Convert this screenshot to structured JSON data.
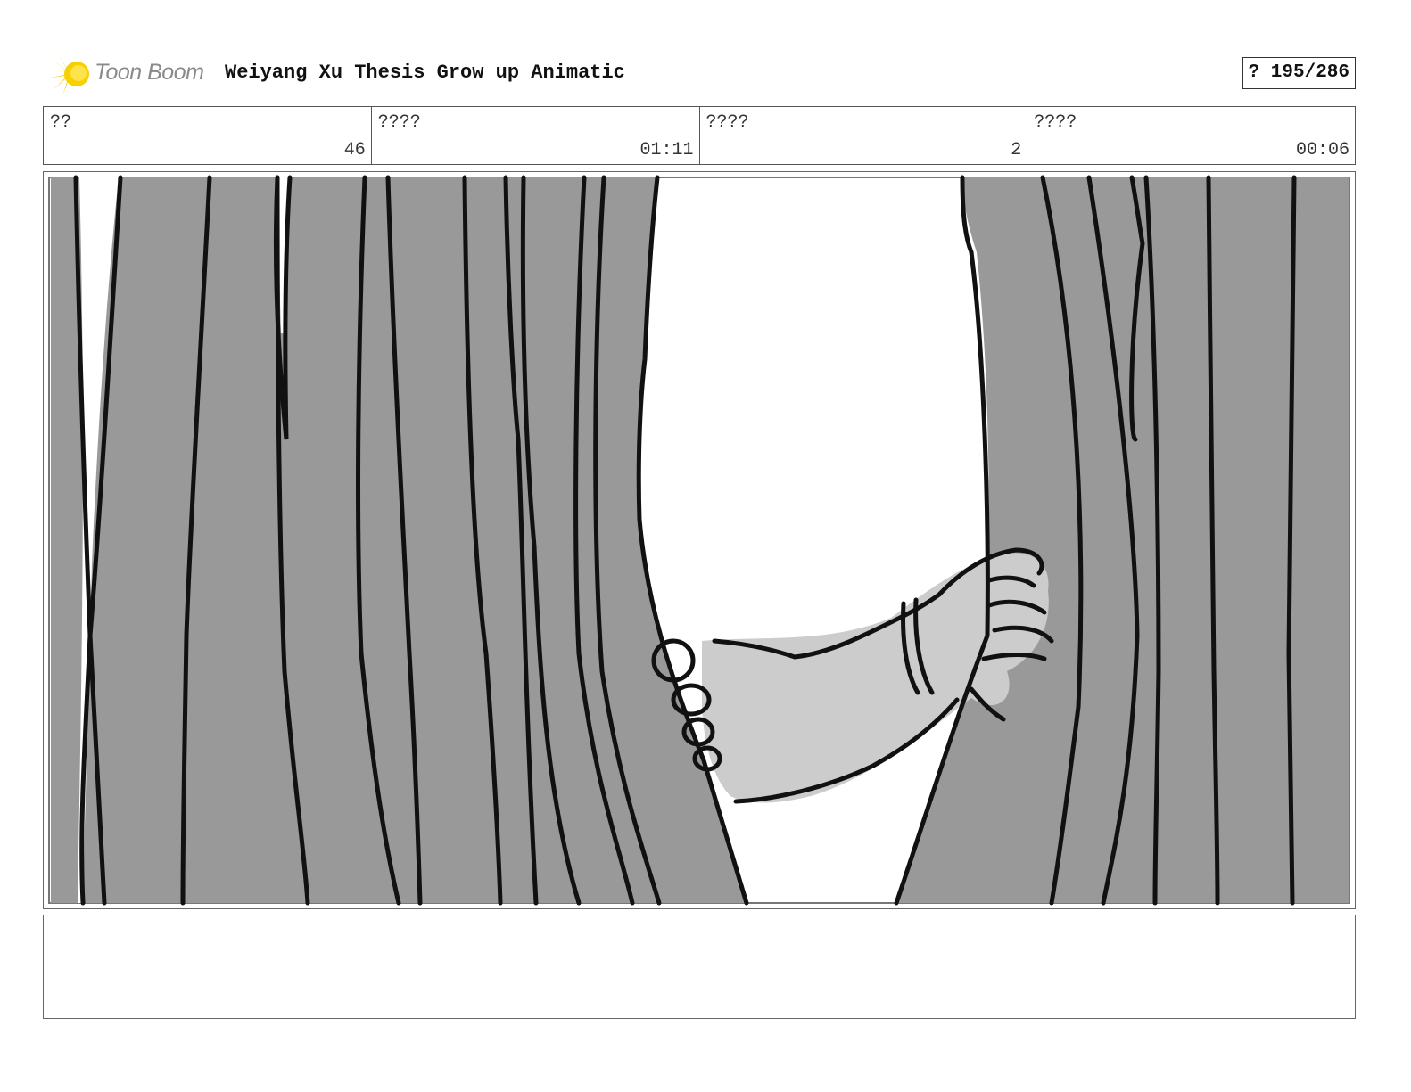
{
  "header": {
    "logo_text": "Toon Boom",
    "title": "Weiyang Xu Thesis Grow up Animatic",
    "page_counter": "? 195/286"
  },
  "info": [
    {
      "label": "??",
      "value": "46"
    },
    {
      "label": "????",
      "value": "01:11"
    },
    {
      "label": "????",
      "value": "2"
    },
    {
      "label": "????",
      "value": "00:06"
    }
  ],
  "panel": {
    "icons": [
      "curtain-drawing",
      "hand-drawing"
    ],
    "colors": {
      "curtain": "#999999",
      "arm": "#cccccc",
      "ink": "#111111",
      "logo": "#f5c400"
    }
  },
  "notes": {
    "text": ""
  }
}
